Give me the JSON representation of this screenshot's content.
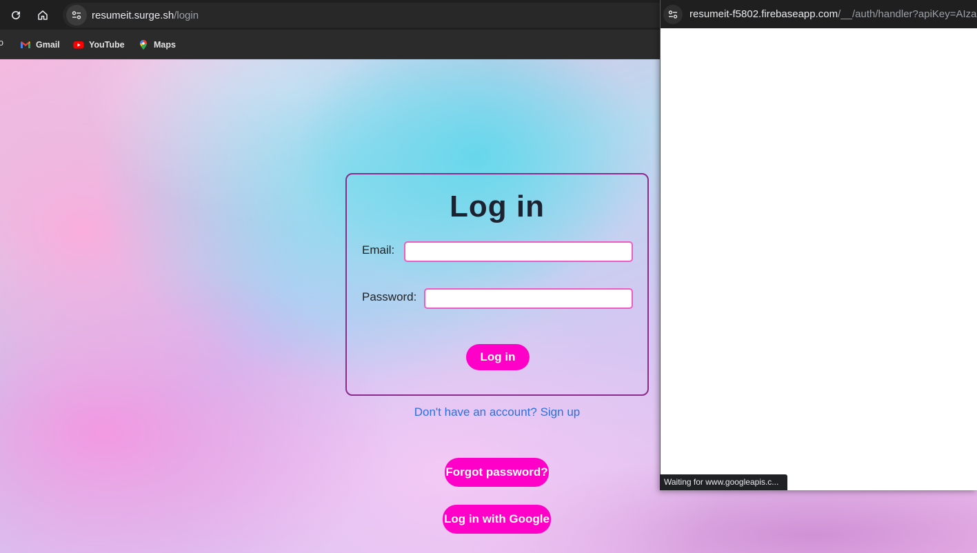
{
  "browser": {
    "url_host": "resumeit.surge.sh",
    "url_path": "/login",
    "bookmarks": [
      {
        "label": "Gmail",
        "icon": "gmail-icon"
      },
      {
        "label": "YouTube",
        "icon": "youtube-icon"
      },
      {
        "label": "Maps",
        "icon": "maps-icon"
      }
    ],
    "bookmark_cut_text": "o"
  },
  "login": {
    "title": "Log in",
    "email_label": "Email:",
    "email_value": "",
    "password_label": "Password:",
    "password_value": "",
    "submit_label": "Log in",
    "signup_link": "Don't have an account? Sign up",
    "forgot_label": "Forgot password?",
    "google_label": "Log in with Google"
  },
  "popup": {
    "url_host": "resumeit-f5802.firebaseapp.com",
    "url_path": "/__/auth/handler?apiKey=AIza",
    "status_text": "Waiting for www.googleapis.c..."
  },
  "colors": {
    "accent_pink": "#ff00c8",
    "card_border": "#8a2a8a",
    "link_blue": "#2b6fe0",
    "input_border": "#ef5bc0"
  }
}
